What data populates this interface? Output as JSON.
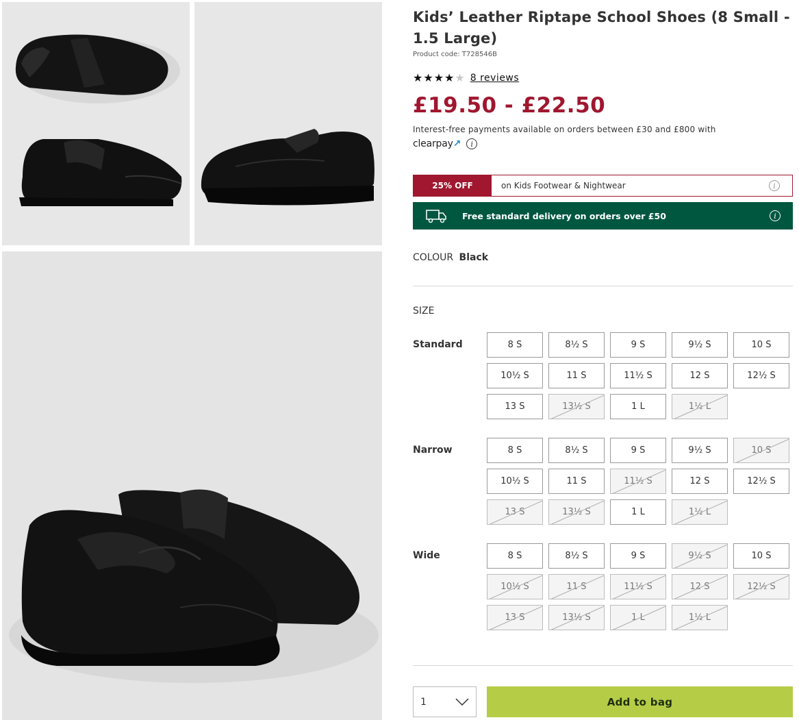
{
  "product": {
    "title": "Kids’ Leather Riptape School Shoes (8 Small - 1.5 Large)",
    "product_code": "Product code: T728546B",
    "rating": 4,
    "rating_max": 5,
    "reviews_label": "8 reviews",
    "price": "£19.50 - £22.50",
    "payments_text": "Interest-free payments available on orders between £30 and £800 with",
    "clearpay_label": "clearpay"
  },
  "promo": {
    "badge": "25% OFF",
    "text": "on Kids Footwear & Nightwear"
  },
  "delivery": {
    "text": "Free standard delivery on orders over £50"
  },
  "colour": {
    "label": "COLOUR",
    "value": "Black"
  },
  "size": {
    "label": "SIZE",
    "groups": [
      {
        "name": "Standard",
        "sizes": [
          {
            "label": "8 S",
            "available": true
          },
          {
            "label": "8½ S",
            "available": true
          },
          {
            "label": "9 S",
            "available": true
          },
          {
            "label": "9½ S",
            "available": true
          },
          {
            "label": "10 S",
            "available": true
          },
          {
            "label": "10½ S",
            "available": true
          },
          {
            "label": "11 S",
            "available": true
          },
          {
            "label": "11½ S",
            "available": true
          },
          {
            "label": "12 S",
            "available": true
          },
          {
            "label": "12½ S",
            "available": true
          },
          {
            "label": "13 S",
            "available": true
          },
          {
            "label": "13½ S",
            "available": false
          },
          {
            "label": "1 L",
            "available": true
          },
          {
            "label": "1½ L",
            "available": false
          }
        ]
      },
      {
        "name": "Narrow",
        "sizes": [
          {
            "label": "8 S",
            "available": true
          },
          {
            "label": "8½ S",
            "available": true
          },
          {
            "label": "9 S",
            "available": true
          },
          {
            "label": "9½ S",
            "available": true
          },
          {
            "label": "10 S",
            "available": false
          },
          {
            "label": "10½ S",
            "available": true
          },
          {
            "label": "11 S",
            "available": true
          },
          {
            "label": "11½ S",
            "available": false
          },
          {
            "label": "12 S",
            "available": true
          },
          {
            "label": "12½ S",
            "available": true
          },
          {
            "label": "13 S",
            "available": false
          },
          {
            "label": "13½ S",
            "available": false
          },
          {
            "label": "1 L",
            "available": true
          },
          {
            "label": "1½ L",
            "available": false
          }
        ]
      },
      {
        "name": "Wide",
        "sizes": [
          {
            "label": "8 S",
            "available": true
          },
          {
            "label": "8½ S",
            "available": true
          },
          {
            "label": "9 S",
            "available": true
          },
          {
            "label": "9½ S",
            "available": false
          },
          {
            "label": "10 S",
            "available": true
          },
          {
            "label": "10½ S",
            "available": false
          },
          {
            "label": "11 S",
            "available": false
          },
          {
            "label": "11½ S",
            "available": false
          },
          {
            "label": "12 S",
            "available": false
          },
          {
            "label": "12½ S",
            "available": false
          },
          {
            "label": "13 S",
            "available": false
          },
          {
            "label": "13½ S",
            "available": false
          },
          {
            "label": "1 L",
            "available": false
          },
          {
            "label": "1½ L",
            "available": false
          }
        ]
      }
    ]
  },
  "purchase": {
    "quantity": "1",
    "add_to_bag": "Add to bag"
  },
  "colors": {
    "price": "#a0172f",
    "promo": "#a0172f",
    "delivery": "#00573f",
    "add_to_bag": "#b5cc46"
  },
  "icons": {
    "star": "star-icon",
    "info": "info-icon",
    "truck": "truck-icon",
    "chevron": "chevron-down-icon"
  }
}
